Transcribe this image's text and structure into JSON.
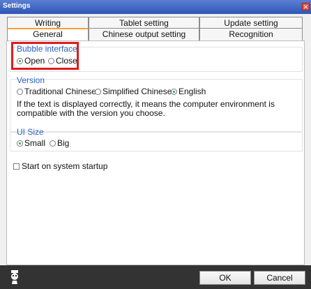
{
  "window": {
    "title": "Settings",
    "close_label": "✕"
  },
  "tabs_row1": [
    {
      "label": "Writing"
    },
    {
      "label": "Tablet setting"
    },
    {
      "label": "Update setting"
    }
  ],
  "tabs_row2": [
    {
      "label": "General",
      "active": true
    },
    {
      "label": "Chinese output setting"
    },
    {
      "label": "Recognition"
    }
  ],
  "bubble": {
    "title": "Bubble interface",
    "options": [
      {
        "label": "Open",
        "selected": true
      },
      {
        "label": "Close",
        "selected": false
      }
    ]
  },
  "version": {
    "title": "Version",
    "options": [
      {
        "label": "Traditional Chinese",
        "selected": false
      },
      {
        "label": "Simplified Chinese",
        "selected": false
      },
      {
        "label": "English",
        "selected": true
      }
    ],
    "description": "If the text is displayed correctly, it means the computer environment is compatible with the version you choose."
  },
  "ui_size": {
    "title": "UI Size",
    "options": [
      {
        "label": "Small",
        "selected": true
      },
      {
        "label": "Big",
        "selected": false
      }
    ]
  },
  "startup": {
    "label": "Start on system startup",
    "checked": false
  },
  "footer": {
    "ok_label": "OK",
    "cancel_label": "Cancel"
  },
  "colors": {
    "accent": "#2b63c8",
    "highlight": "#e01b1b",
    "footer": "#333333",
    "radio_on": "#2aa54b"
  }
}
